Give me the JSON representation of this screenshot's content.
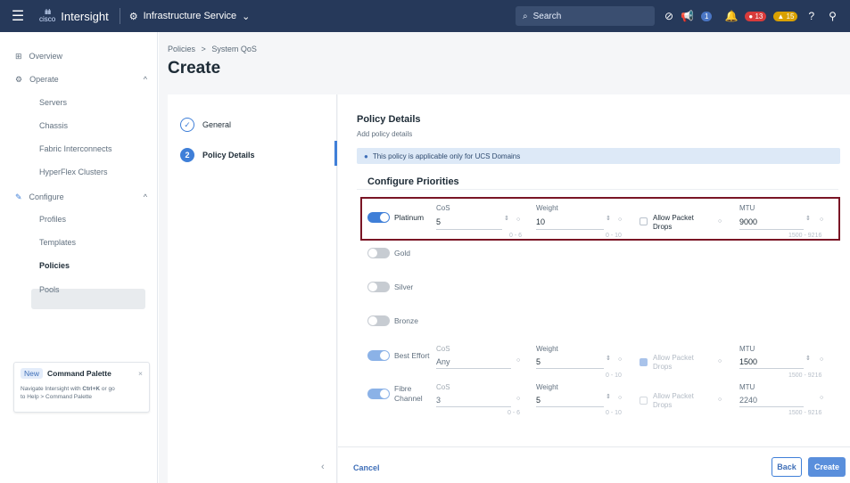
{
  "topbar": {
    "logo_text": "cisco",
    "app_name": "Intersight",
    "service": "Infrastructure Service",
    "search_label": "Search",
    "notif_count": "1",
    "alarms_critical": "13",
    "alarms_warning": "15"
  },
  "sidebar": {
    "overview": "Overview",
    "operate": "Operate",
    "operate_items": [
      "Servers",
      "Chassis",
      "Fabric Interconnects",
      "HyperFlex Clusters"
    ],
    "configure": "Configure",
    "configure_items": [
      "Profiles",
      "Templates",
      "Policies",
      "Pools"
    ],
    "palette": {
      "badge": "New",
      "title": "Command Palette",
      "line1": "Navigate Intersight with",
      "shortcut": "Ctrl+K",
      "line1b": "or go",
      "line2": "to",
      "line2b": "Help > Command Palette"
    }
  },
  "breadcrumb": {
    "root": "Policies",
    "sep": ">",
    "current": "System QoS"
  },
  "page_title": "Create",
  "steps": [
    {
      "number": "✓",
      "label": "General"
    },
    {
      "number": "2",
      "label": "Policy Details"
    }
  ],
  "details": {
    "title": "Policy Details",
    "subtitle": "Add policy details",
    "info": "This policy is applicable only for UCS Domains",
    "section": "Configure Priorities"
  },
  "labels": {
    "cos": "CoS",
    "weight": "Weight",
    "mtu": "MTU",
    "allow": "Allow Packet",
    "drops": "Drops"
  },
  "priorities": {
    "platinum": {
      "name": "Platinum",
      "enabled": true,
      "cos": "5",
      "cos_hint": "0 - 6",
      "weight": "10",
      "weight_hint": "0 - 10",
      "mtu": "9000",
      "mtu_hint": "1500 - 9216"
    },
    "gold": {
      "name": "Gold",
      "enabled": false
    },
    "silver": {
      "name": "Silver",
      "enabled": false
    },
    "bronze": {
      "name": "Bronze",
      "enabled": false
    },
    "best_effort": {
      "name": "Best Effort",
      "enabled": true,
      "cos": "Any",
      "weight": "5",
      "weight_hint": "0 - 10",
      "mtu": "1500",
      "mtu_hint": "1500 - 9216"
    },
    "fibre": {
      "name_l1": "Fibre",
      "name_l2": "Channel",
      "enabled": true,
      "cos": "3",
      "cos_hint": "0 - 6",
      "weight": "5",
      "weight_hint": "0 - 10",
      "mtu": "2240",
      "mtu_hint": "1500 - 9216"
    }
  },
  "footer": {
    "cancel": "Cancel",
    "back": "Back",
    "create": "Create"
  },
  "colors": {
    "accent": "#3f7fd8",
    "topbar": "#26395a",
    "highlight_box": "#7a1525",
    "critical": "#d83b3b",
    "warning": "#d9a100"
  }
}
